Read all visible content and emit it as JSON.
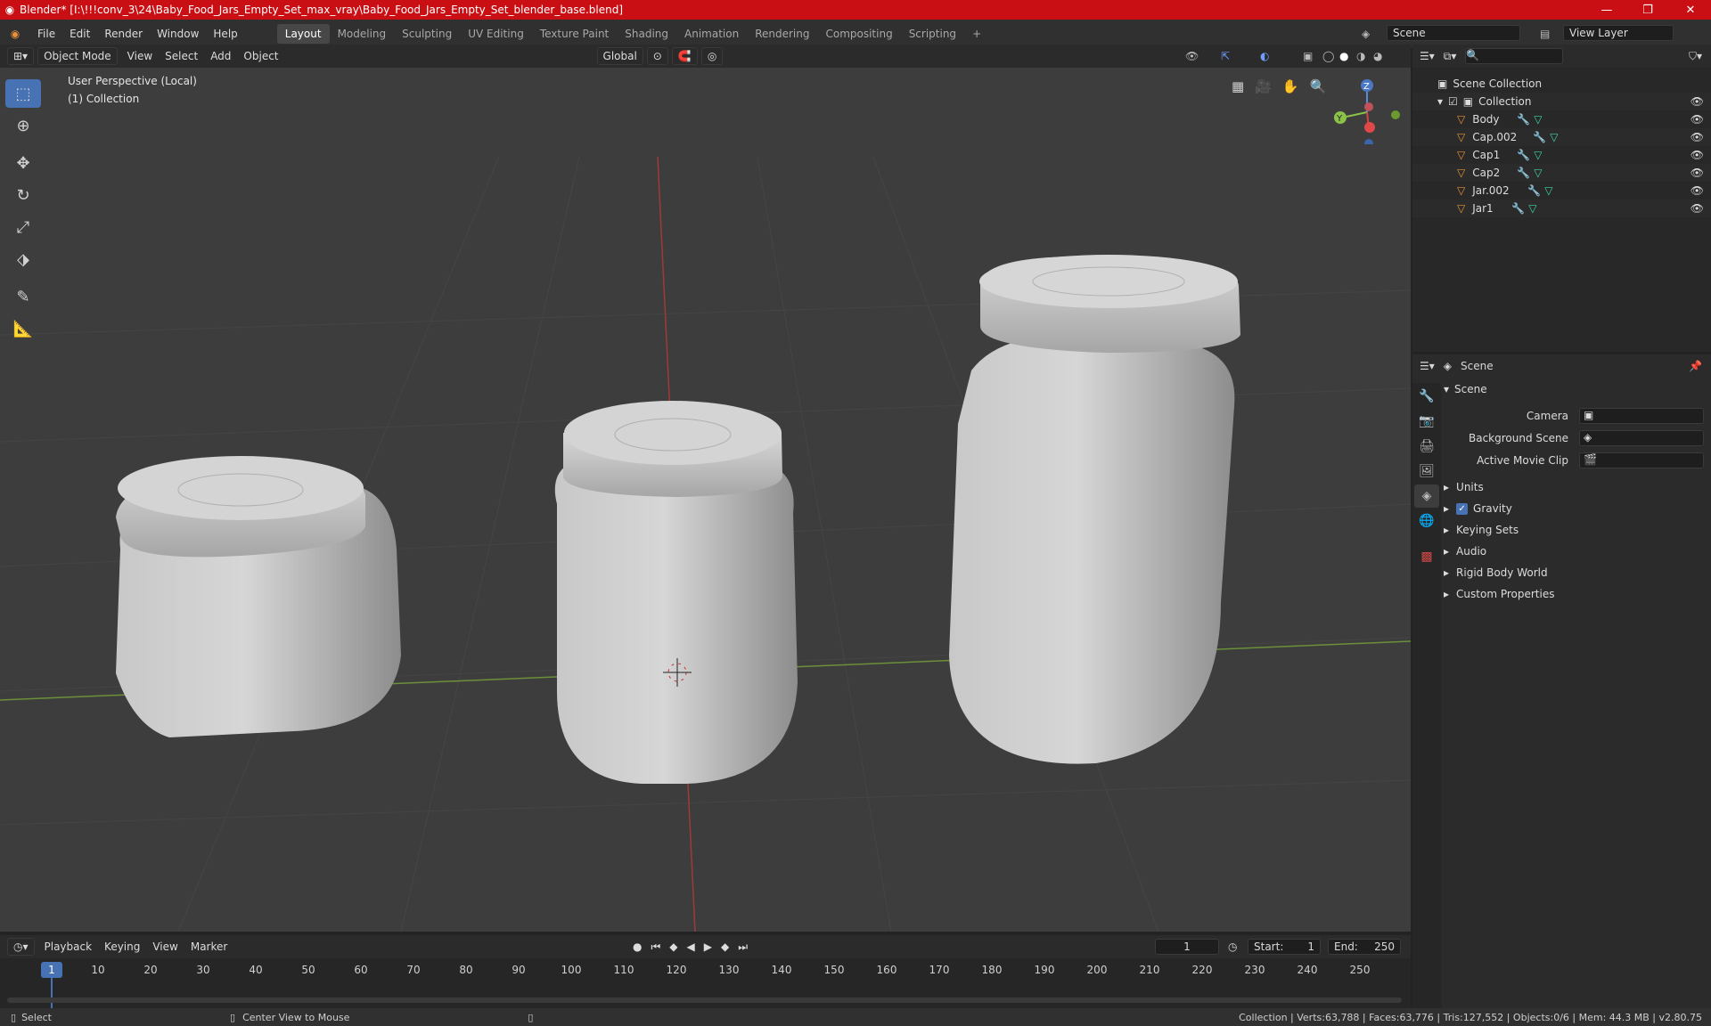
{
  "title_bar": {
    "title": "Blender* [I:\\!!!conv_3\\24\\Baby_Food_Jars_Empty_Set_max_vray\\Baby_Food_Jars_Empty_Set_blender_base.blend]"
  },
  "menu": [
    "File",
    "Edit",
    "Render",
    "Window",
    "Help"
  ],
  "workspaces": [
    "Layout",
    "Modeling",
    "Sculpting",
    "UV Editing",
    "Texture Paint",
    "Shading",
    "Animation",
    "Rendering",
    "Compositing",
    "Scripting"
  ],
  "scene_selector": {
    "scene": "Scene",
    "view_layer": "View Layer"
  },
  "viewport_header": {
    "mode": "Object Mode",
    "menus": [
      "View",
      "Select",
      "Add",
      "Object"
    ],
    "transform_orientation": "Global"
  },
  "viewport": {
    "perspective_label": "User Perspective (Local)",
    "collection_label": "(1) Collection"
  },
  "gizmo": {
    "z": "Z",
    "y": "Y"
  },
  "outliner": {
    "root": "Scene Collection",
    "collection": "Collection",
    "items": [
      "Body",
      "Cap.002",
      "Cap1",
      "Cap2",
      "Jar.002",
      "Jar1"
    ]
  },
  "properties": {
    "context": "Scene",
    "panel": "Scene",
    "fields": [
      {
        "label": "Camera"
      },
      {
        "label": "Background Scene"
      },
      {
        "label": "Active Movie Clip"
      }
    ],
    "sections": [
      "Units",
      "Gravity",
      "Keying Sets",
      "Audio",
      "Rigid Body World",
      "Custom Properties"
    ],
    "gravity_checked": true
  },
  "timeline": {
    "menus": [
      "Playback",
      "Keying",
      "View",
      "Marker"
    ],
    "current_frame": "1",
    "start_label": "Start:",
    "start": "1",
    "end_label": "End:",
    "end": "250",
    "ticks": [
      "1",
      "10",
      "20",
      "30",
      "40",
      "50",
      "60",
      "70",
      "80",
      "90",
      "100",
      "110",
      "120",
      "130",
      "140",
      "150",
      "160",
      "170",
      "180",
      "190",
      "200",
      "210",
      "220",
      "230",
      "240",
      "250"
    ]
  },
  "status": {
    "select": "Select",
    "center": "Center View to Mouse",
    "info": "Collection | Verts:63,788 | Faces:63,776 | Tris:127,552 | Objects:0/6 | Mem: 44.3 MB | v2.80.75"
  },
  "colors": {
    "accent": "#4772b3",
    "title_bg": "#c90f14",
    "orange_icon": "#e8903a"
  }
}
